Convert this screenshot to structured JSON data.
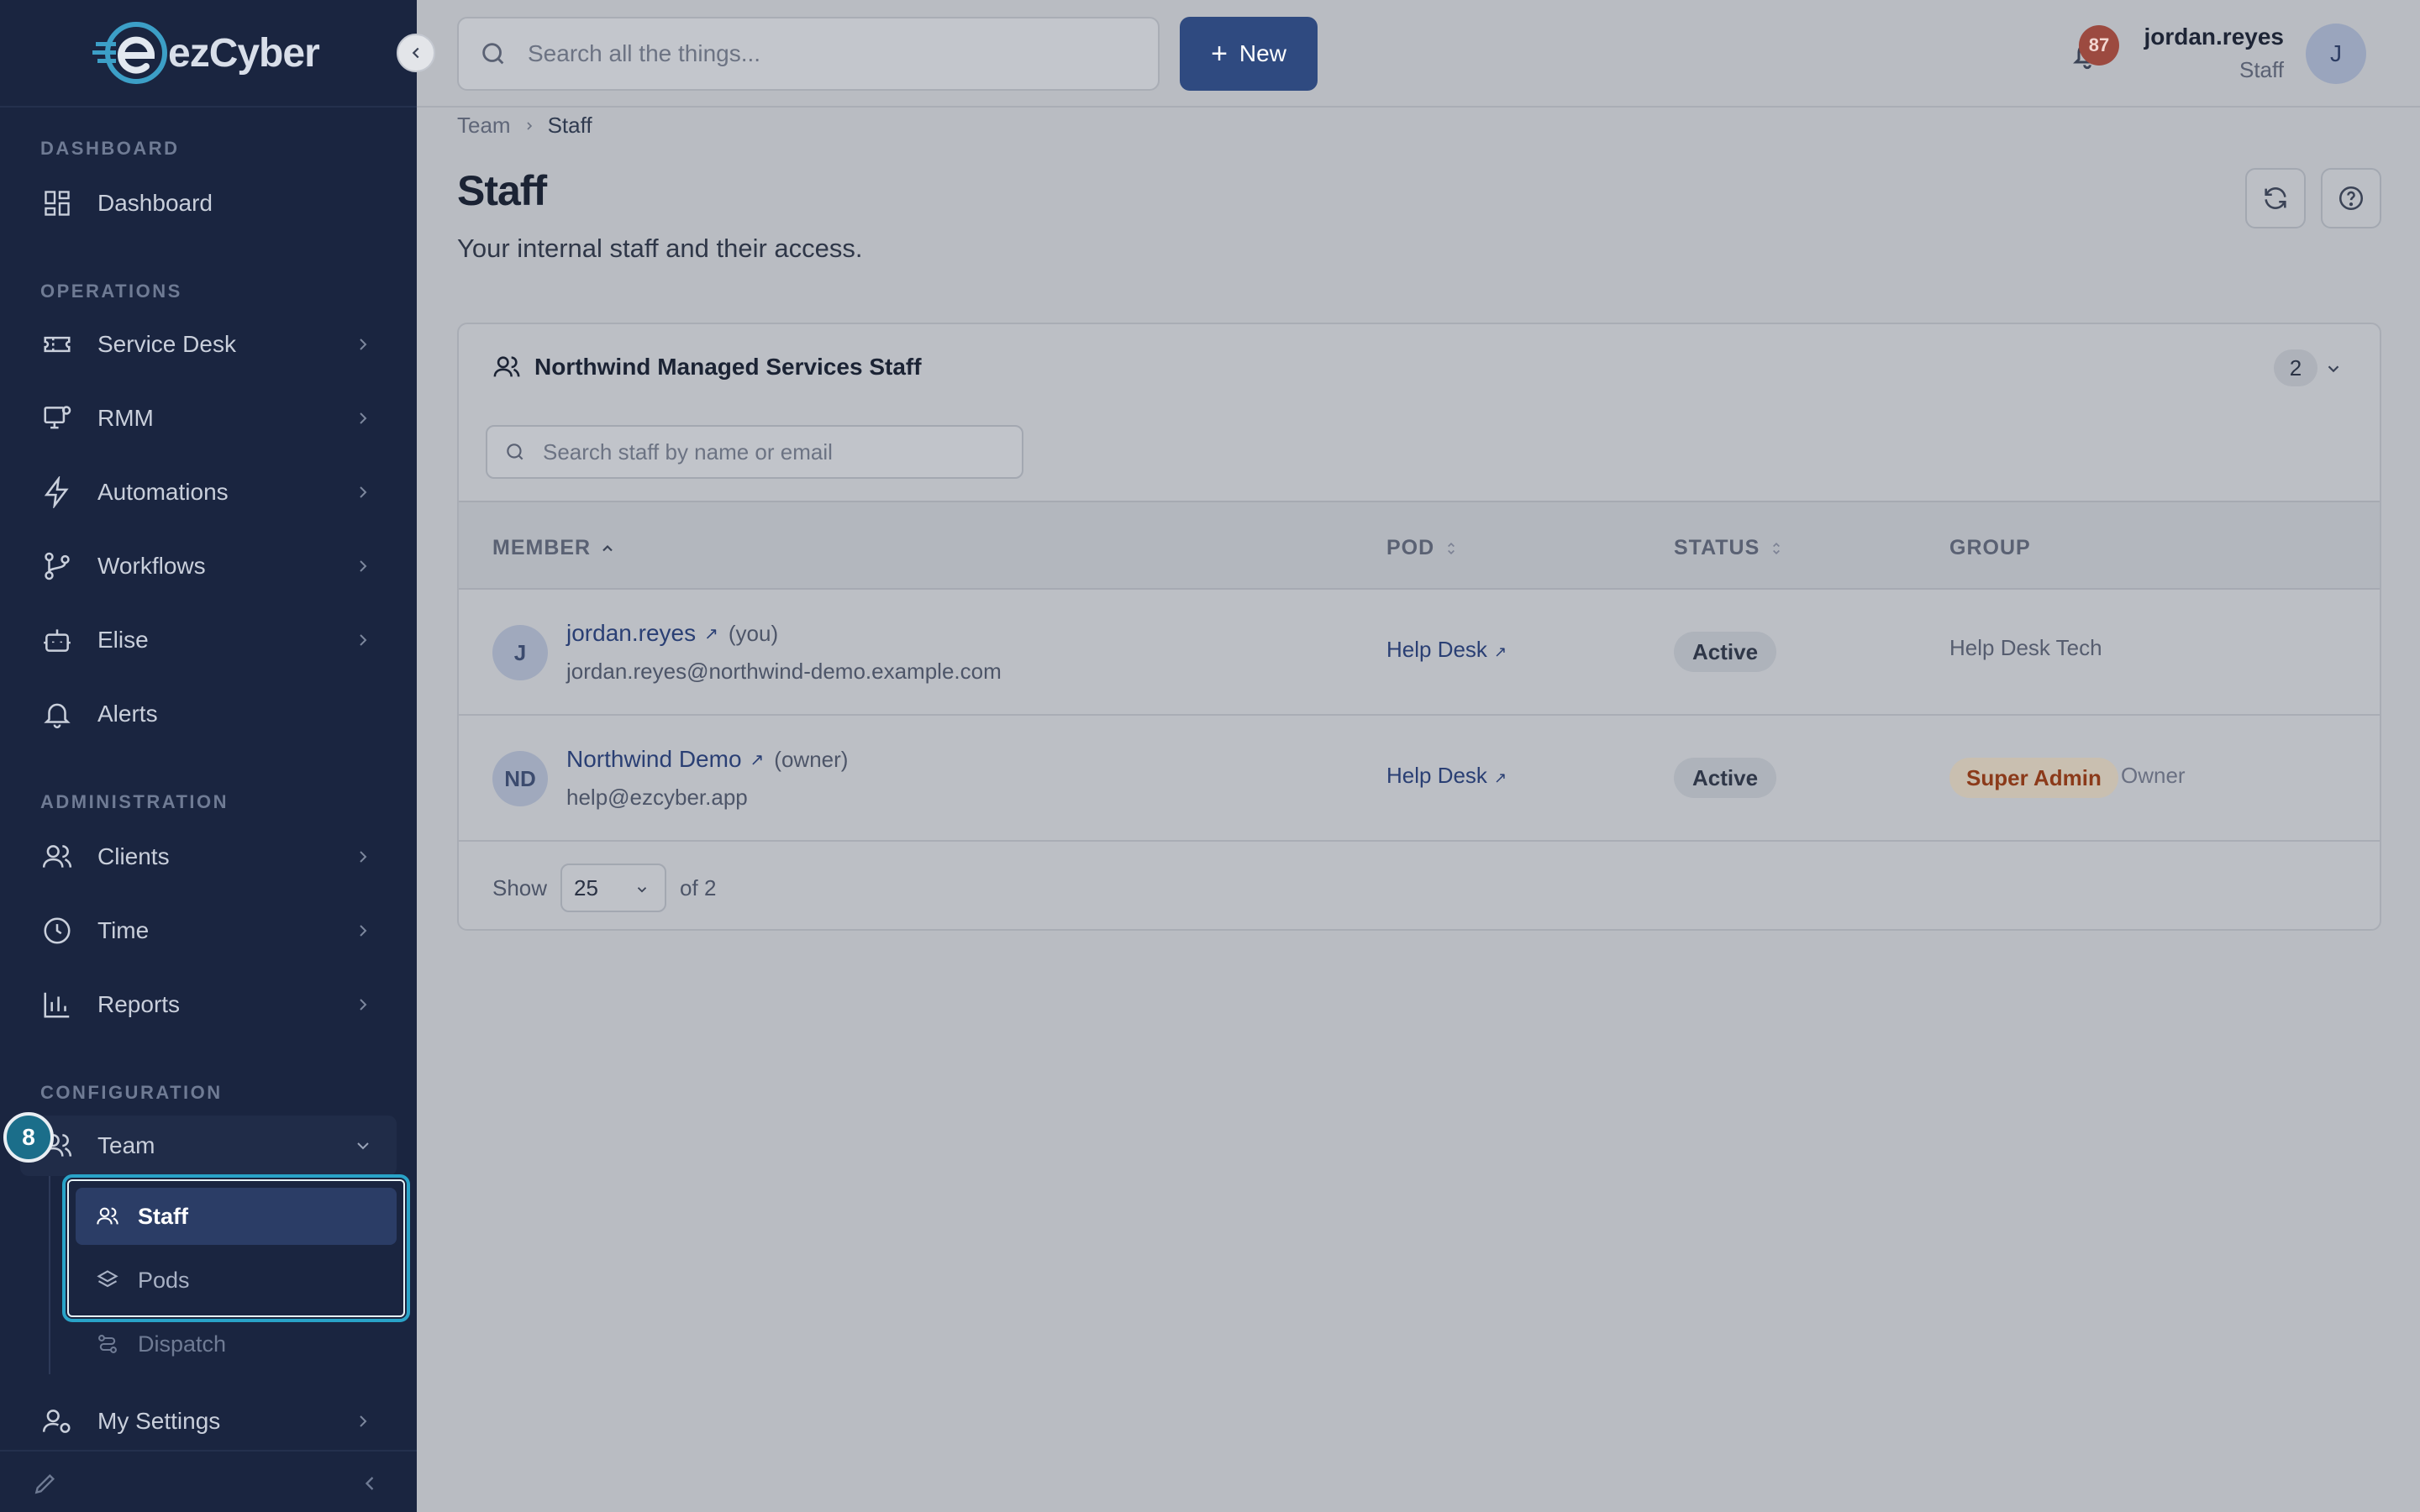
{
  "brand": {
    "name": "ezCyber"
  },
  "topbar": {
    "search_placeholder": "Search all the things...",
    "new_label": "New",
    "notification_count": "87",
    "user_name": "jordan.reyes",
    "user_role": "Staff",
    "user_initial": "J"
  },
  "sidebar": {
    "sections": {
      "dashboard": "DASHBOARD",
      "operations": "OPERATIONS",
      "administration": "ADMINISTRATION",
      "configuration": "CONFIGURATION"
    },
    "items": {
      "dashboard": "Dashboard",
      "service_desk": "Service Desk",
      "rmm": "RMM",
      "automations": "Automations",
      "workflows": "Workflows",
      "elise": "Elise",
      "alerts": "Alerts",
      "clients": "Clients",
      "time": "Time",
      "reports": "Reports",
      "team": "Team",
      "my_settings": "My Settings"
    },
    "team_submenu": {
      "staff": "Staff",
      "pods": "Pods",
      "dispatch": "Dispatch"
    },
    "step_badge": "8"
  },
  "breadcrumb": {
    "parent": "Team",
    "current": "Staff"
  },
  "page": {
    "title": "Staff",
    "subtitle": "Your internal staff and their access."
  },
  "card": {
    "title": "Northwind Managed Services Staff",
    "count": "2",
    "search_placeholder": "Search staff by name or email",
    "columns": {
      "member": "MEMBER",
      "pod": "POD",
      "status": "STATUS",
      "group": "GROUP"
    },
    "rows": [
      {
        "initials": "J",
        "name": "jordan.reyes",
        "tag": "(you)",
        "email": "jordan.reyes@northwind-demo.example.com",
        "pod": "Help Desk",
        "status": "Active",
        "group": "Help Desk Tech"
      },
      {
        "initials": "ND",
        "name": "Northwind Demo",
        "tag": "(owner)",
        "email": "help@ezcyber.app",
        "pod": "Help Desk",
        "status": "Active",
        "role": "Super Admin",
        "group": "Owner"
      }
    ],
    "footer": {
      "show_label": "Show",
      "page_size": "25",
      "of_label": "of 2"
    }
  },
  "colors": {
    "sidebar_bg": "#1a2540",
    "accent": "#2f4a80",
    "highlight": "#29a3c8",
    "notify": "#9c4a40"
  }
}
